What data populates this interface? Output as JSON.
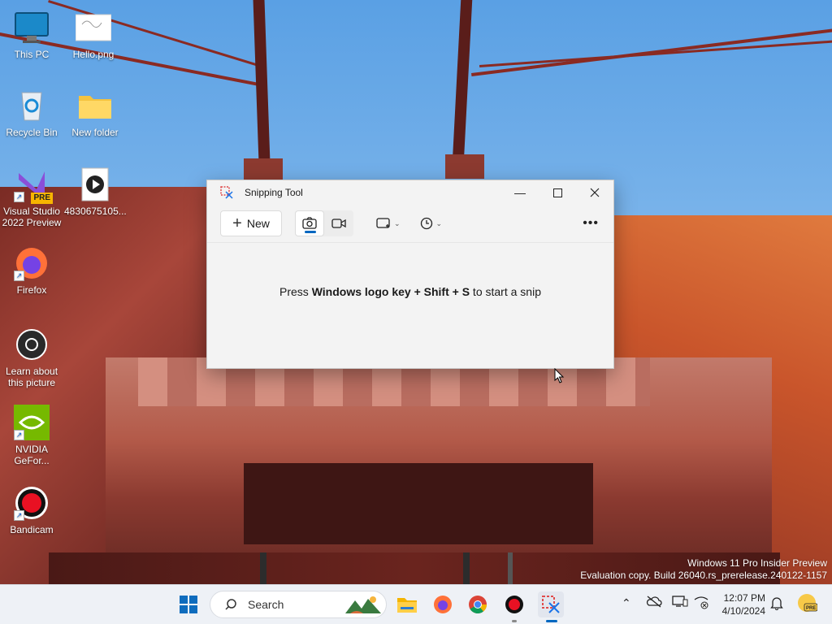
{
  "desktop": {
    "icons": [
      {
        "label": "This PC",
        "icon": "monitor-icon"
      },
      {
        "label": "Hello.png",
        "icon": "image-file-icon"
      },
      {
        "label": "Recycle Bin",
        "icon": "recycle-bin-icon"
      },
      {
        "label": "New folder",
        "icon": "folder-icon"
      },
      {
        "label": "Visual Studio 2022 Preview",
        "icon": "visual-studio-icon",
        "badge": "PRE"
      },
      {
        "label": "4830675105...",
        "icon": "media-file-icon"
      },
      {
        "label": "Firefox",
        "icon": "firefox-icon"
      },
      {
        "label": "Learn about this picture",
        "icon": "camera-circle-icon"
      },
      {
        "label": "NVIDIA GeFor...",
        "icon": "nvidia-icon"
      },
      {
        "label": "Bandicam",
        "icon": "bandicam-icon"
      }
    ],
    "watermark_line1": "Windows 11 Pro Insider Preview",
    "watermark_line2": "Evaluation copy. Build 26040.rs_prerelease.240122-1157"
  },
  "snipping_tool": {
    "title": "Snipping Tool",
    "new_label": "New",
    "modes": [
      "camera-icon",
      "video-icon"
    ],
    "message_prefix": "Press ",
    "message_bold": "Windows logo key + Shift + S",
    "message_suffix": " to start a snip"
  },
  "taskbar": {
    "search_placeholder": "Search",
    "apps": [
      "start-icon",
      "file-explorer-icon",
      "firefox-icon",
      "chrome-icon",
      "bandicam-icon",
      "snipping-tool-icon"
    ],
    "time": "12:07 PM",
    "date": "4/10/2024"
  },
  "colors": {
    "accent": "#0067c0",
    "taskbar_bg": "#eef1f6",
    "window_bg": "#f3f3f3"
  }
}
